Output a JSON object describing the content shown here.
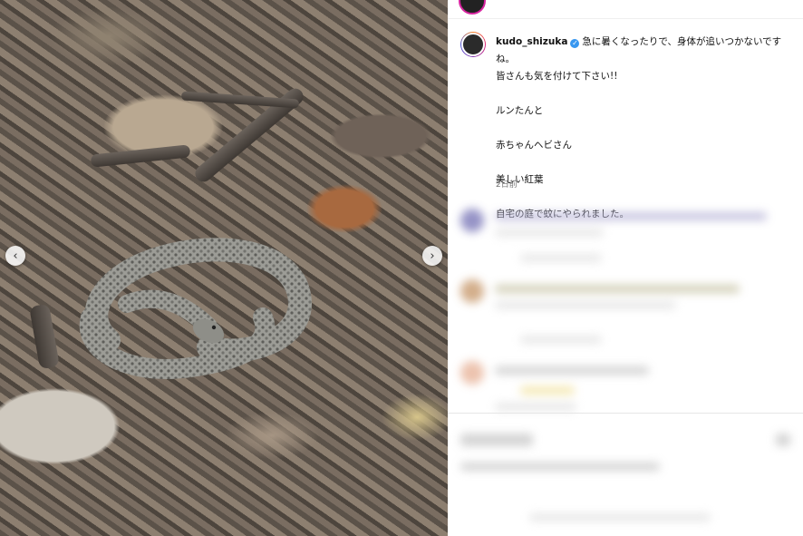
{
  "post": {
    "username": "kudo_shizuka",
    "verified": true,
    "caption_lines": [
      "急に暑くなったりで、身体が追いつかないですね。",
      "皆さんも気を付けて下さい!!",
      "",
      "ルンたんと",
      "",
      "赤ちゃんヘビさん",
      "",
      "美しい紅葉",
      "",
      "自宅の庭で蚊にやられました。"
    ],
    "timestamp": "2日前"
  },
  "icons": {
    "verified": "verified-badge-icon",
    "prev": "chevron-left-icon",
    "next": "chevron-right-icon"
  },
  "colors": {
    "verified_blue": "#3897f0",
    "timestamp_gray": "#737373"
  }
}
